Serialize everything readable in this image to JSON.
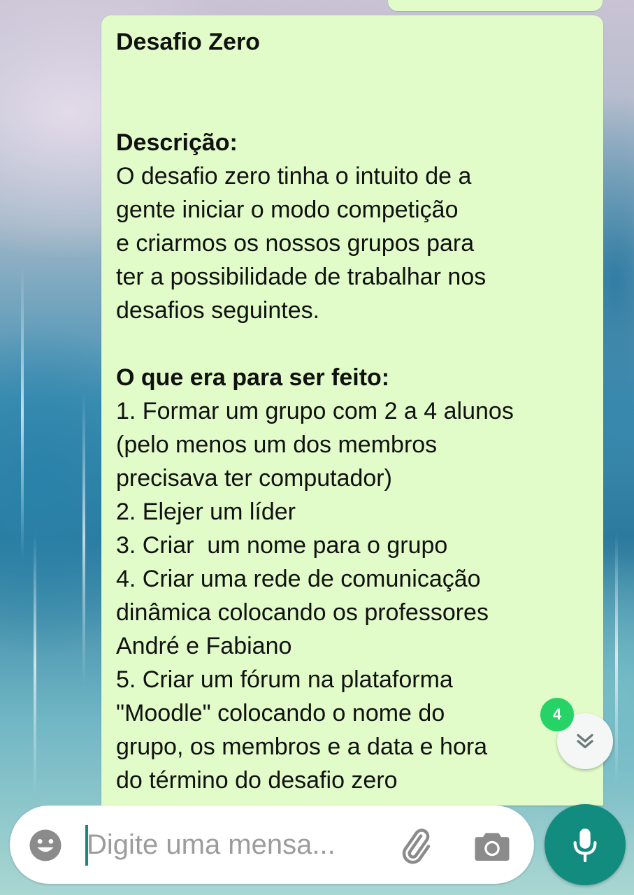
{
  "message": {
    "title": "Desafio Zero",
    "description_heading": "Descrição:",
    "description_lines": [
      "O desafio zero tinha o intuito de a",
      "gente iniciar o modo competição",
      "e criarmos os nossos grupos para",
      "ter a possibilidade de trabalhar nos",
      "desafios seguintes."
    ],
    "todo_heading": "O que era para ser feito:",
    "todo_lines": [
      "1. Formar um grupo com 2 a 4 alunos",
      "(pelo menos um dos membros",
      "precisava ter computador)",
      "2. Elejer um líder",
      "3. Criar  um nome para o grupo",
      "4. Criar uma rede de comunicação",
      "dinâmica colocando os professores",
      "André e Fabiano",
      "5. Criar um fórum na plataforma",
      "\"Moodle\" colocando o nome do",
      "grupo, os membros e a data e hora",
      "do término do desafio zero"
    ]
  },
  "scroll": {
    "unread_count": "4"
  },
  "composer": {
    "placeholder": "Digite uma mensa..."
  },
  "icons": {
    "emoji": "emoji-icon",
    "attach": "paperclip-icon",
    "camera": "camera-icon",
    "mic": "microphone-icon",
    "scroll": "double-chevron-down-icon"
  },
  "colors": {
    "bubble": "#e1fcc9",
    "accent": "#128c7e",
    "badge": "#25d366"
  }
}
